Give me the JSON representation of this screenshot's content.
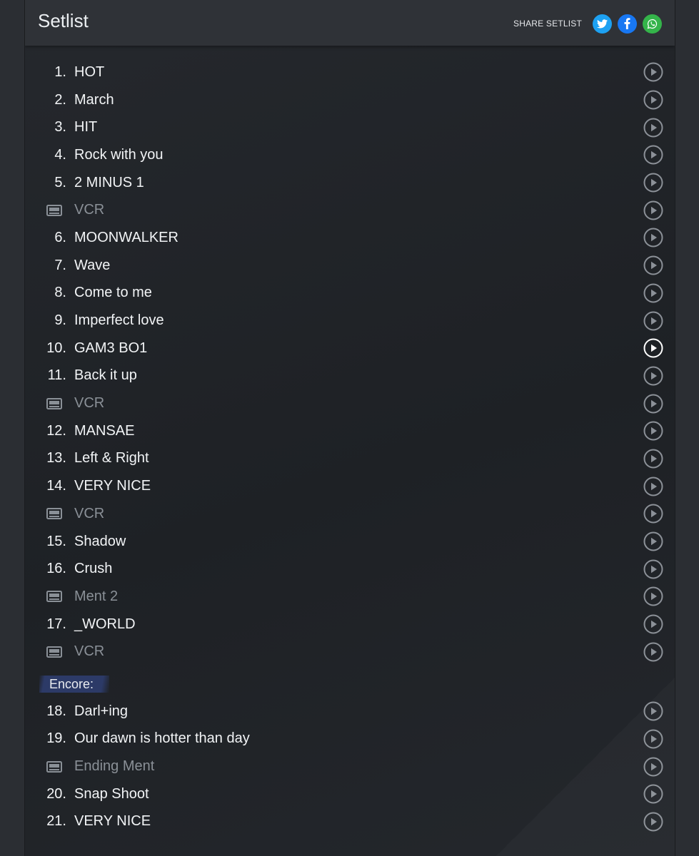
{
  "header": {
    "title": "Setlist",
    "share_label": "SHARE SETLIST",
    "twitter_color": "#1da1f2",
    "facebook_color": "#1877f2",
    "whatsapp_color": "#34b44a"
  },
  "main_set": [
    {
      "num": "1.",
      "title": "HOT",
      "type": "song"
    },
    {
      "num": "2.",
      "title": "March",
      "type": "song"
    },
    {
      "num": "3.",
      "title": "HIT",
      "type": "song"
    },
    {
      "num": "4.",
      "title": "Rock with you",
      "type": "song"
    },
    {
      "num": "5.",
      "title": "2 MINUS 1",
      "type": "song"
    },
    {
      "num": "",
      "title": "VCR",
      "type": "tape"
    },
    {
      "num": "6.",
      "title": "MOONWALKER",
      "type": "song"
    },
    {
      "num": "7.",
      "title": "Wave",
      "type": "song"
    },
    {
      "num": "8.",
      "title": "Come to me",
      "type": "song"
    },
    {
      "num": "9.",
      "title": "Imperfect love",
      "type": "song"
    },
    {
      "num": "10.",
      "title": "GAM3 BO1",
      "type": "song",
      "highlight": true
    },
    {
      "num": "11.",
      "title": "Back it up",
      "type": "song"
    },
    {
      "num": "",
      "title": "VCR",
      "type": "tape"
    },
    {
      "num": "12.",
      "title": "MANSAE",
      "type": "song"
    },
    {
      "num": "13.",
      "title": "Left & Right",
      "type": "song"
    },
    {
      "num": "14.",
      "title": "VERY NICE",
      "type": "song"
    },
    {
      "num": "",
      "title": "VCR",
      "type": "tape"
    },
    {
      "num": "15.",
      "title": "Shadow",
      "type": "song"
    },
    {
      "num": "16.",
      "title": "Crush",
      "type": "song"
    },
    {
      "num": "",
      "title": "Ment 2",
      "type": "tape"
    },
    {
      "num": "17.",
      "title": "_WORLD",
      "type": "song"
    },
    {
      "num": "",
      "title": "VCR",
      "type": "tape"
    }
  ],
  "encore_label": "Encore:",
  "encore_set": [
    {
      "num": "18.",
      "title": "Darl+ing",
      "type": "song"
    },
    {
      "num": "19.",
      "title": "Our dawn is hotter than day",
      "type": "song"
    },
    {
      "num": "",
      "title": "Ending Ment",
      "type": "tape"
    },
    {
      "num": "20.",
      "title": "Snap Shoot",
      "type": "song"
    },
    {
      "num": "21.",
      "title": "VERY NICE",
      "type": "song"
    }
  ]
}
